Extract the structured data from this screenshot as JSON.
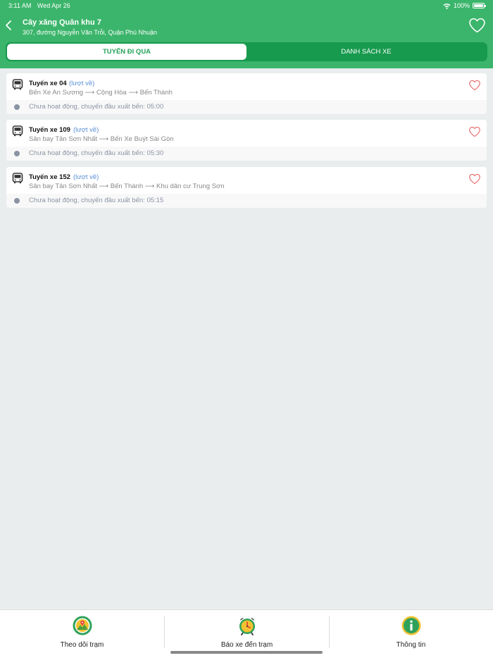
{
  "status_bar": {
    "time": "3:11 AM",
    "date": "Wed Apr 26",
    "battery": "100%"
  },
  "header": {
    "stop_name": "Cây xăng Quân khu 7",
    "stop_address": "307, đường Nguyễn Văn Trỗi, Quận Phú Nhuận",
    "back_icon": "chevron-left-icon",
    "favorite_icon": "heart-outline-icon"
  },
  "segments": [
    {
      "label": "Tuyến đi qua",
      "selected": true
    },
    {
      "label": "Danh sách xe",
      "selected": false
    }
  ],
  "routes": [
    {
      "name": "Tuyến xe 04",
      "direction": "(lượt về)",
      "path": "Bến Xe An Sương ⟶ Cộng Hòa ⟶ Bến Thành",
      "status": "Chưa hoạt động, chuyến đầu xuất bến: 05:00"
    },
    {
      "name": "Tuyến xe 109",
      "direction": "(lượt về)",
      "path": "Sân bay Tân Sơn Nhất ⟶ Bến Xe Buýt Sài Gòn",
      "status": "Chưa hoạt động, chuyến đầu xuất bến: 05:30"
    },
    {
      "name": "Tuyến xe 152",
      "direction": "(lượt về)",
      "path": "Sân bay Tân Sơn Nhất ⟶ Bến Thành ⟶ Khu dân cư Trung Sơn",
      "status": "Chưa hoạt động, chuyến đầu xuất bến: 05:15"
    }
  ],
  "tabbar": [
    {
      "label": "Theo dõi trạm",
      "icon": "map-pin-icon"
    },
    {
      "label": "Báo xe đến trạm",
      "icon": "alarm-clock-icon"
    },
    {
      "label": "Thông tin",
      "icon": "info-icon"
    }
  ],
  "colors": {
    "brand_green": "#3bb56b",
    "segment_dark_green": "#179a4e",
    "heart_red": "#e86a6a",
    "direction_blue": "#5b8fd6",
    "background": "#e9eded"
  }
}
